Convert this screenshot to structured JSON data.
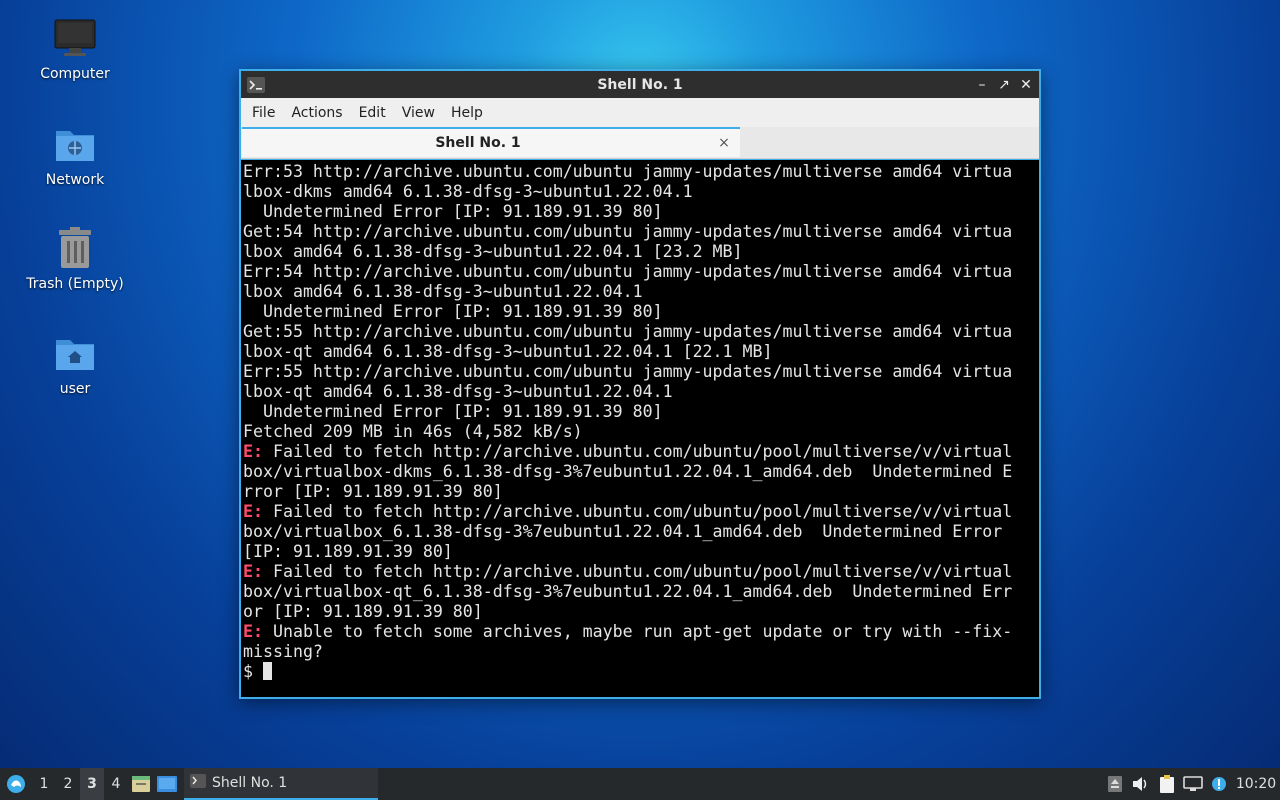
{
  "desktop": {
    "icons": [
      {
        "label": "Computer",
        "icon": "computer-icon"
      },
      {
        "label": "Network",
        "icon": "network-folder-icon"
      },
      {
        "label": "Trash (Empty)",
        "icon": "trash-icon"
      },
      {
        "label": "user",
        "icon": "home-folder-icon"
      }
    ]
  },
  "window": {
    "title": "Shell No. 1",
    "menu": [
      "File",
      "Actions",
      "Edit",
      "View",
      "Help"
    ],
    "tab_label": "Shell No. 1",
    "close_tab_glyph": "×",
    "controls": {
      "minimize": "–",
      "maximize": "↗",
      "close": "✕"
    }
  },
  "terminal": {
    "error_prefix": "E:",
    "lines": [
      "Err:53 http://archive.ubuntu.com/ubuntu jammy-updates/multiverse amd64 virtua",
      "lbox-dkms amd64 6.1.38-dfsg-3~ubuntu1.22.04.1",
      "  Undetermined Error [IP: 91.189.91.39 80]",
      "Get:54 http://archive.ubuntu.com/ubuntu jammy-updates/multiverse amd64 virtua",
      "lbox amd64 6.1.38-dfsg-3~ubuntu1.22.04.1 [23.2 MB]",
      "Err:54 http://archive.ubuntu.com/ubuntu jammy-updates/multiverse amd64 virtua",
      "lbox amd64 6.1.38-dfsg-3~ubuntu1.22.04.1",
      "  Undetermined Error [IP: 91.189.91.39 80]",
      "Get:55 http://archive.ubuntu.com/ubuntu jammy-updates/multiverse amd64 virtua",
      "lbox-qt amd64 6.1.38-dfsg-3~ubuntu1.22.04.1 [22.1 MB]",
      "Err:55 http://archive.ubuntu.com/ubuntu jammy-updates/multiverse amd64 virtua",
      "lbox-qt amd64 6.1.38-dfsg-3~ubuntu1.22.04.1",
      "  Undetermined Error [IP: 91.189.91.39 80]",
      "Fetched 209 MB in 46s (4,582 kB/s)",
      " Failed to fetch http://archive.ubuntu.com/ubuntu/pool/multiverse/v/virtual",
      "box/virtualbox-dkms_6.1.38-dfsg-3%7eubuntu1.22.04.1_amd64.deb  Undetermined E",
      "rror [IP: 91.189.91.39 80]",
      " Failed to fetch http://archive.ubuntu.com/ubuntu/pool/multiverse/v/virtual",
      "box/virtualbox_6.1.38-dfsg-3%7eubuntu1.22.04.1_amd64.deb  Undetermined Error",
      "[IP: 91.189.91.39 80]",
      " Failed to fetch http://archive.ubuntu.com/ubuntu/pool/multiverse/v/virtual",
      "box/virtualbox-qt_6.1.38-dfsg-3%7eubuntu1.22.04.1_amd64.deb  Undetermined Err",
      "or [IP: 91.189.91.39 80]",
      " Unable to fetch some archives, maybe run apt-get update or try with --fix-",
      "missing?"
    ],
    "error_line_indexes": [
      14,
      17,
      20,
      23
    ],
    "prompt": "$ "
  },
  "taskbar": {
    "workspaces": [
      "1",
      "2",
      "3",
      "4"
    ],
    "active_workspace": "3",
    "task_title": "Shell No. 1",
    "clock": "10:20"
  },
  "colors": {
    "accent": "#3daee9",
    "error": "#ff4b6a",
    "terminal_bg": "#000000",
    "taskbar_bg": "#26292c"
  }
}
